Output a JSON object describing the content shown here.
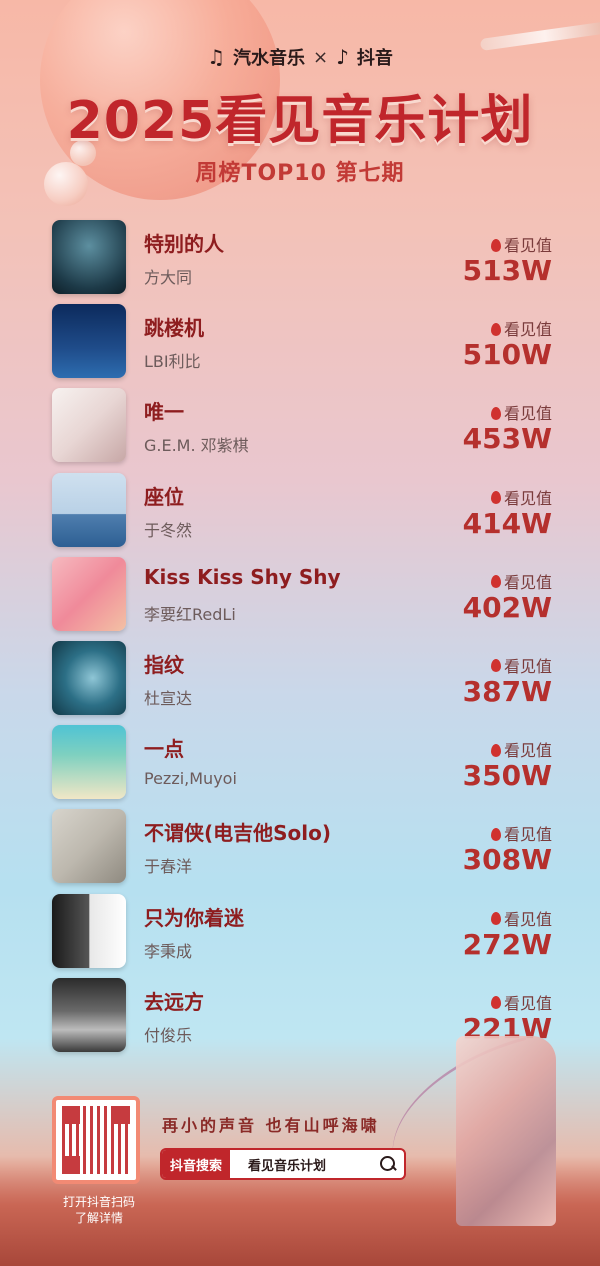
{
  "header": {
    "brand_left": "汽水音乐",
    "brand_sep": "×",
    "brand_right": "抖音",
    "title": "2025看见音乐计划",
    "subtitle": "周榜TOP10 第七期"
  },
  "metric_label": "看见值",
  "songs": [
    {
      "title": "特别的人",
      "artist": "方大同",
      "value": "513W"
    },
    {
      "title": "跳楼机",
      "artist": "LBI利比",
      "value": "510W"
    },
    {
      "title": "唯一",
      "artist": "G.E.M. 邓紫棋",
      "value": "453W"
    },
    {
      "title": "座位",
      "artist": "于冬然",
      "value": "414W"
    },
    {
      "title": "Kiss Kiss Shy Shy",
      "artist": "李要红RedLi",
      "value": "402W"
    },
    {
      "title": "指纹",
      "artist": "杜宣达",
      "value": "387W"
    },
    {
      "title": "一点",
      "artist": "Pezzi,Muyoi",
      "value": "350W"
    },
    {
      "title": "不谓侠(电吉他Solo)",
      "artist": "于春洋",
      "value": "308W"
    },
    {
      "title": "只为你着迷",
      "artist": "李秉成",
      "value": "272W"
    },
    {
      "title": "去远方",
      "artist": "付俊乐",
      "value": "221W"
    }
  ],
  "footer": {
    "qr_caption_1": "打开抖音扫码",
    "qr_caption_2": "了解详情",
    "slogan": "再小的声音 也有山呼海啸",
    "search_tag": "抖音搜索",
    "search_text": "看见音乐计划"
  }
}
